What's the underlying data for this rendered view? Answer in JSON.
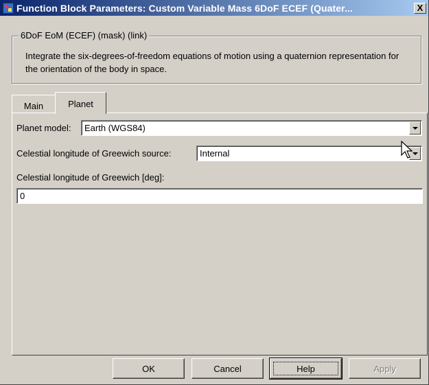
{
  "window": {
    "title": "Function Block Parameters: Custom Variable Mass 6DoF ECEF (Quater...",
    "close_label": "X"
  },
  "description": {
    "group_title": "6DoF EoM (ECEF) (mask) (link)",
    "text": "Integrate the six-degrees-of-freedom equations of motion using a quaternion representation for the orientation of the body in space."
  },
  "tabs": [
    {
      "label": "Main",
      "active": false
    },
    {
      "label": "Planet",
      "active": true
    }
  ],
  "planet_tab": {
    "planet_model": {
      "label": "Planet model:",
      "value": "Earth (WGS84)"
    },
    "greenwich_source": {
      "label": "Celestial longitude of Greewich source:",
      "value": "Internal"
    },
    "greenwich_deg": {
      "label": "Celestial longitude of Greewich [deg]:",
      "value": "0"
    }
  },
  "buttons": {
    "ok": "OK",
    "cancel": "Cancel",
    "help": "Help",
    "apply": "Apply"
  },
  "icons": {
    "app": "simulink-block-icon",
    "close": "close-icon",
    "dropdown": "chevron-down-icon",
    "cursor": "mouse-pointer-icon"
  },
  "colors": {
    "titlebar_start": "#0a246a",
    "titlebar_end": "#a6caf0",
    "dialog_bg": "#d4d0c8"
  }
}
